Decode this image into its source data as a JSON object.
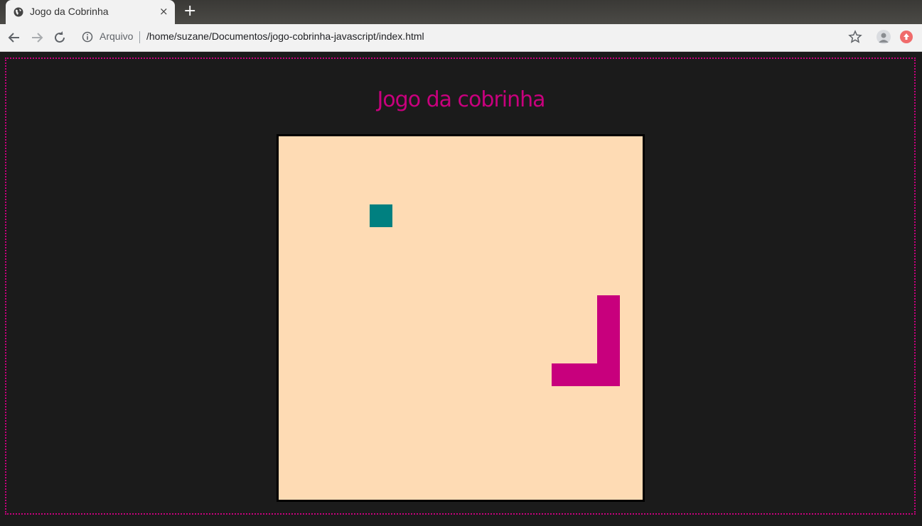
{
  "browser": {
    "tab_title": "Jogo da Cobrinha",
    "close_glyph": "×",
    "new_tab_glyph": "+",
    "icons": [
      "globe-icon",
      "back-icon",
      "forward-icon",
      "reload-icon",
      "info-icon",
      "star-icon",
      "profile-icon",
      "extension-icon"
    ]
  },
  "omnibox": {
    "security_label": "Arquivo",
    "url": "/home/suzane/Documentos/jogo-cobrinha-javascript/index.html"
  },
  "page": {
    "heading": "Jogo da cobrinha",
    "colors": {
      "background": "#1b1b1b",
      "accent": "#c8007d",
      "board": "#fedbb4",
      "snake": "#c8007d",
      "food": "#008080"
    }
  },
  "game": {
    "grid_columns": 16,
    "grid_rows": 16,
    "food": {
      "col": 4,
      "row": 3
    },
    "snake": [
      {
        "col": 14,
        "row": 7
      },
      {
        "col": 14,
        "row": 8
      },
      {
        "col": 14,
        "row": 9
      },
      {
        "col": 13,
        "row": 10
      },
      {
        "col": 12,
        "row": 10
      },
      {
        "col": 14,
        "row": 10
      }
    ]
  }
}
